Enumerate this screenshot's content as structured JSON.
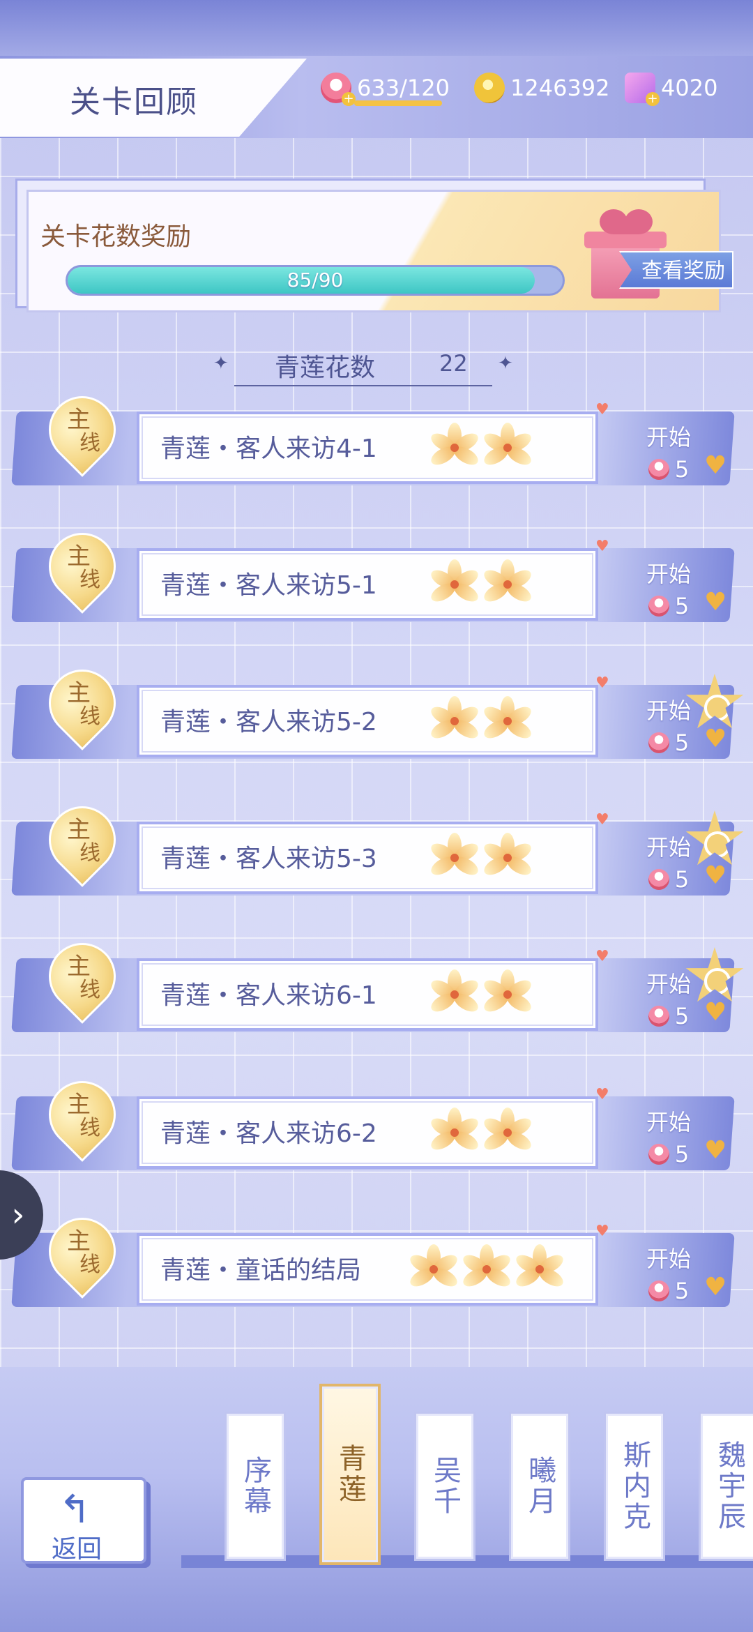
{
  "header": {
    "title": "关卡回顾",
    "stamina": "633/120",
    "coins": "1246392",
    "gems": "4020"
  },
  "reward": {
    "title": "关卡花数奖励",
    "progress_text": "85/90",
    "progress_fraction": 0.944,
    "view_button": "查看奖励"
  },
  "flower_count": {
    "label": "青莲花数",
    "value": "22"
  },
  "levels": [
    {
      "tag_top": "主",
      "tag_bottom": "线",
      "name": "青莲・客人来访4-1",
      "flowers": 2,
      "start": "开始",
      "cost": "5",
      "star": false
    },
    {
      "tag_top": "主",
      "tag_bottom": "线",
      "name": "青莲・客人来访5-1",
      "flowers": 2,
      "start": "开始",
      "cost": "5",
      "star": false
    },
    {
      "tag_top": "主",
      "tag_bottom": "线",
      "name": "青莲・客人来访5-2",
      "flowers": 2,
      "start": "开始",
      "cost": "5",
      "star": true
    },
    {
      "tag_top": "主",
      "tag_bottom": "线",
      "name": "青莲・客人来访5-3",
      "flowers": 2,
      "start": "开始",
      "cost": "5",
      "star": true
    },
    {
      "tag_top": "主",
      "tag_bottom": "线",
      "name": "青莲・客人来访6-1",
      "flowers": 2,
      "start": "开始",
      "cost": "5",
      "star": true
    },
    {
      "tag_top": "主",
      "tag_bottom": "线",
      "name": "青莲・客人来访6-2",
      "flowers": 2,
      "start": "开始",
      "cost": "5",
      "star": false
    },
    {
      "tag_top": "主",
      "tag_bottom": "线",
      "name": "青莲・童话的结局",
      "flowers": 3,
      "start": "开始",
      "cost": "5",
      "star": false
    }
  ],
  "back_button": "返回",
  "tabs": [
    {
      "label": "序幕",
      "active": false
    },
    {
      "label": "青莲",
      "active": true
    },
    {
      "label": "吴千",
      "active": false
    },
    {
      "label": "曦月",
      "active": false
    },
    {
      "label": "斯内克",
      "active": false
    },
    {
      "label": "魏宇辰",
      "active": false
    }
  ]
}
